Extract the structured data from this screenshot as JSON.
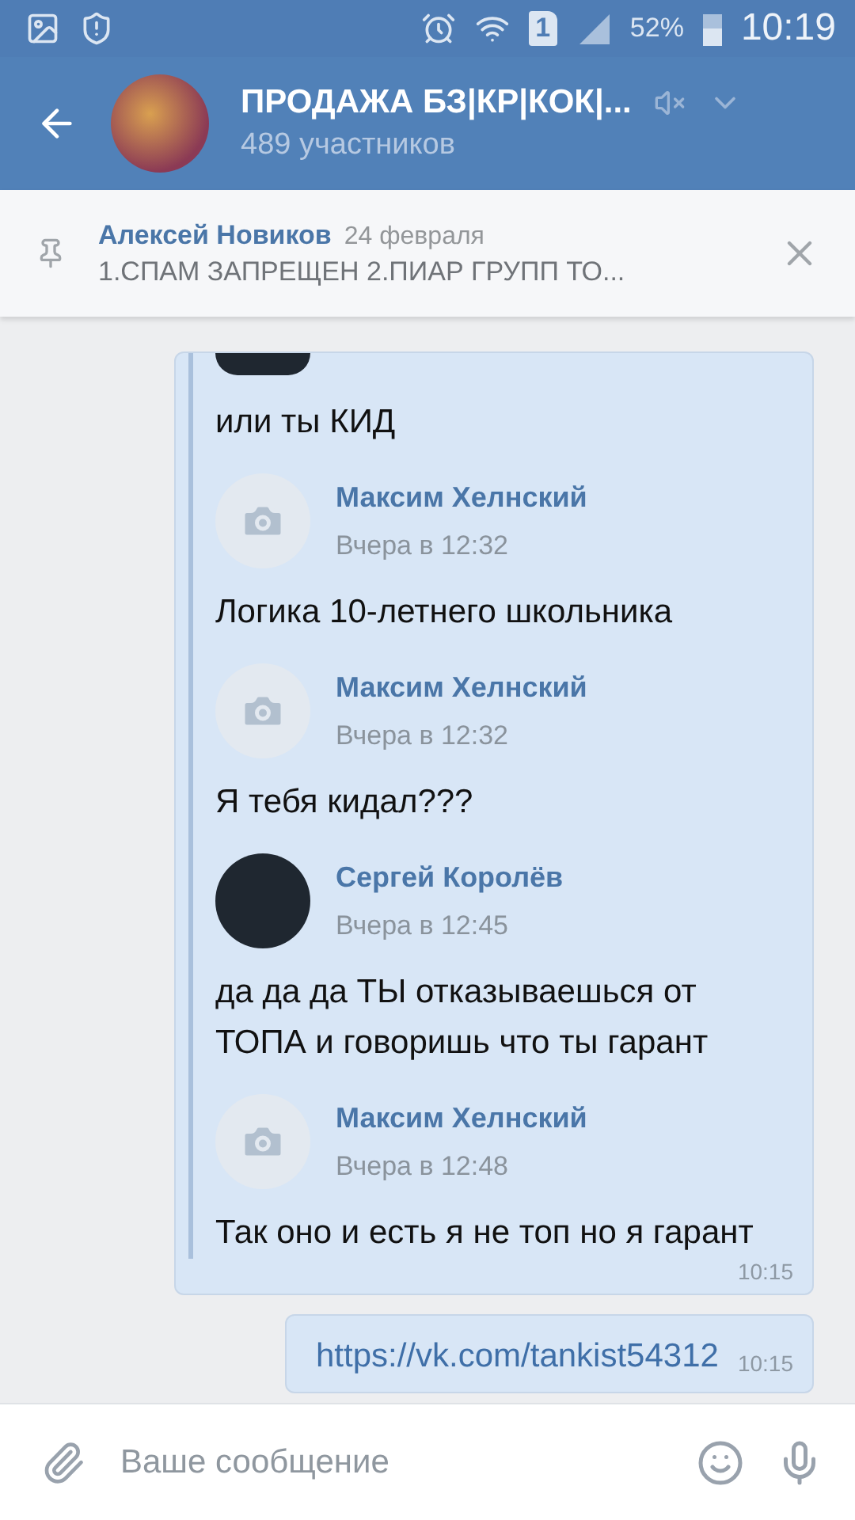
{
  "status_bar": {
    "sim": "1",
    "battery": "52%",
    "time": "10:19"
  },
  "header": {
    "title": "ПРОДАЖА БЗ|КР|КОК|...",
    "subtitle": "489 участников",
    "muted": true
  },
  "pinned": {
    "author": "Алексей Новиков",
    "date": "24 февраля",
    "text": "1.СПАМ ЗАПРЕЩЕН  2.ПИАР ГРУПП ТО..."
  },
  "messages": [
    {
      "kind": "forward",
      "time": "10:15",
      "items": [
        {
          "text": "или ты КИД"
        },
        {
          "author": "Максим Хелнский",
          "date": "Вчера в 12:32",
          "kind": "camera",
          "text": "Логика 10-летнего школьника"
        },
        {
          "author": "Максим Хелнский",
          "date": "Вчера в 12:32",
          "kind": "camera",
          "text": "Я тебя кидал???"
        },
        {
          "author": "Сергей Королёв",
          "date": "Вчера в 12:45",
          "kind": "photo",
          "text": "да да да ТЫ отказываешься от ТОПА и говоришь что ты гарант"
        },
        {
          "author": "Максим Хелнский",
          "date": "Вчера в 12:48",
          "kind": "camera",
          "text": "Так оно и есть я не топ но я гарант"
        }
      ]
    },
    {
      "kind": "link",
      "text": "https://vk.com/tankist54312",
      "time": "10:15"
    }
  ],
  "composer": {
    "placeholder": "Ваше сообщение"
  }
}
